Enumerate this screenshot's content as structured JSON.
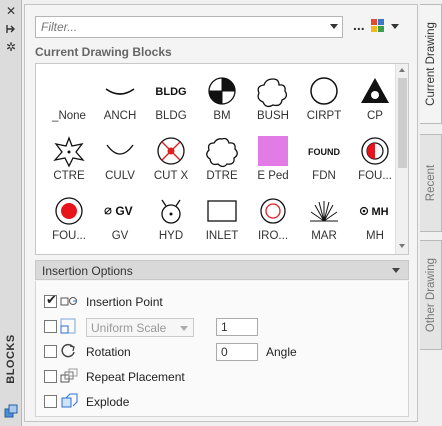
{
  "palette_title": "BLOCKS",
  "filter": {
    "placeholder": "Filter..."
  },
  "more_label": "...",
  "section_title": "Current Drawing Blocks",
  "blocks": [
    {
      "label": "_None",
      "icon": "none"
    },
    {
      "label": "ANCH",
      "icon": "anch"
    },
    {
      "label": "BLDG",
      "icon": "bldg"
    },
    {
      "label": "BM",
      "icon": "bm"
    },
    {
      "label": "BUSH",
      "icon": "bush"
    },
    {
      "label": "CIRPT",
      "icon": "cirpt"
    },
    {
      "label": "CP",
      "icon": "cp"
    },
    {
      "label": "CTRE",
      "icon": "ctre"
    },
    {
      "label": "CULV",
      "icon": "culv"
    },
    {
      "label": "CUT X",
      "icon": "cutx"
    },
    {
      "label": "DTRE",
      "icon": "dtre"
    },
    {
      "label": "E Ped",
      "icon": "eped"
    },
    {
      "label": "FDN",
      "icon": "fdn"
    },
    {
      "label": "FOU...",
      "icon": "fou1"
    },
    {
      "label": "FOU...",
      "icon": "fou2"
    },
    {
      "label": "GV",
      "icon": "gv"
    },
    {
      "label": "HYD",
      "icon": "hyd"
    },
    {
      "label": "INLET",
      "icon": "inlet"
    },
    {
      "label": "IRO...",
      "icon": "iro"
    },
    {
      "label": "MAR",
      "icon": "mar"
    },
    {
      "label": "MH",
      "icon": "mh"
    }
  ],
  "block_texts": {
    "bldg": "BLDG",
    "fdn": "FOUND",
    "gv": "GV",
    "mh": "MH"
  },
  "colors": {
    "eped_fill": "#e27be6",
    "fou1_fill": "#e8141b",
    "cutx_red": "#e02020"
  },
  "insertion": {
    "header": "Insertion Options",
    "insertion_point": {
      "label": "Insertion Point",
      "checked": true
    },
    "uniform_scale": {
      "label": "Uniform Scale",
      "value": "1",
      "checked": false
    },
    "rotation": {
      "label": "Rotation",
      "value": "0",
      "angle_label": "Angle",
      "checked": false
    },
    "repeat_placement": {
      "label": "Repeat Placement",
      "checked": false
    },
    "explode": {
      "label": "Explode",
      "checked": false
    }
  },
  "tabs": [
    {
      "label": "Current Drawing",
      "active": true
    },
    {
      "label": "Recent",
      "active": false
    },
    {
      "label": "Other Drawing",
      "active": false
    }
  ]
}
